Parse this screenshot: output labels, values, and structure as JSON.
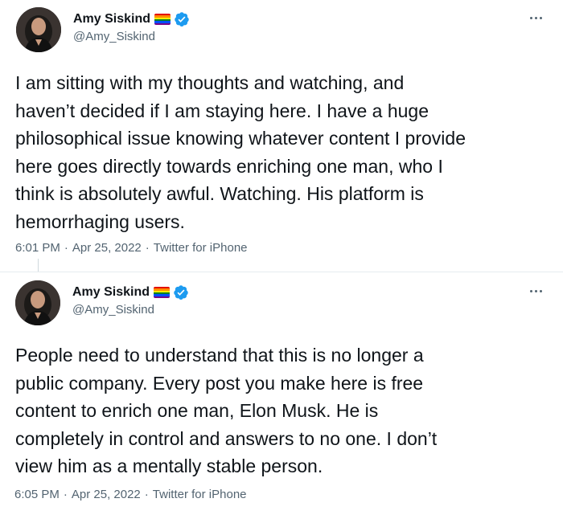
{
  "tweets": [
    {
      "author": {
        "display_name": "Amy Siskind",
        "handle": "@Amy_Siskind",
        "flag_icon": "rainbow-flag-icon",
        "verified_icon": "verified-badge-icon",
        "avatar_icon": "avatar"
      },
      "lines": [
        "I am sitting with my thoughts and watching, and",
        "haven’t decided if I am staying here. I have a huge",
        "philosophical issue knowing whatever content I provide",
        "here goes directly towards enriching one man, who I",
        "think is absolutely awful. Watching. His platform is",
        "hemorrhaging users."
      ],
      "time": "6:01 PM",
      "date": "Apr 25, 2022",
      "source": "Twitter for iPhone",
      "more_icon": "more-options-icon"
    },
    {
      "author": {
        "display_name": "Amy Siskind",
        "handle": "@Amy_Siskind",
        "flag_icon": "rainbow-flag-icon",
        "verified_icon": "verified-badge-icon",
        "avatar_icon": "avatar"
      },
      "lines": [
        "People need to understand that this is no longer a",
        "public company. Every post you make here is free",
        "content to enrich one man, Elon Musk. He is",
        "completely in control and answers to no one. I don’t",
        "view him as a mentally stable person."
      ],
      "time": "6:05 PM",
      "date": "Apr 25, 2022",
      "source": "Twitter for iPhone",
      "more_icon": "more-options-icon"
    }
  ],
  "colors": {
    "text_primary": "#0f1419",
    "text_secondary": "#536471",
    "verified_blue": "#1d9bf0",
    "flag": [
      "#e40303",
      "#ff8c00",
      "#ffed00",
      "#008026",
      "#004dff",
      "#750787"
    ]
  },
  "separator": "·"
}
